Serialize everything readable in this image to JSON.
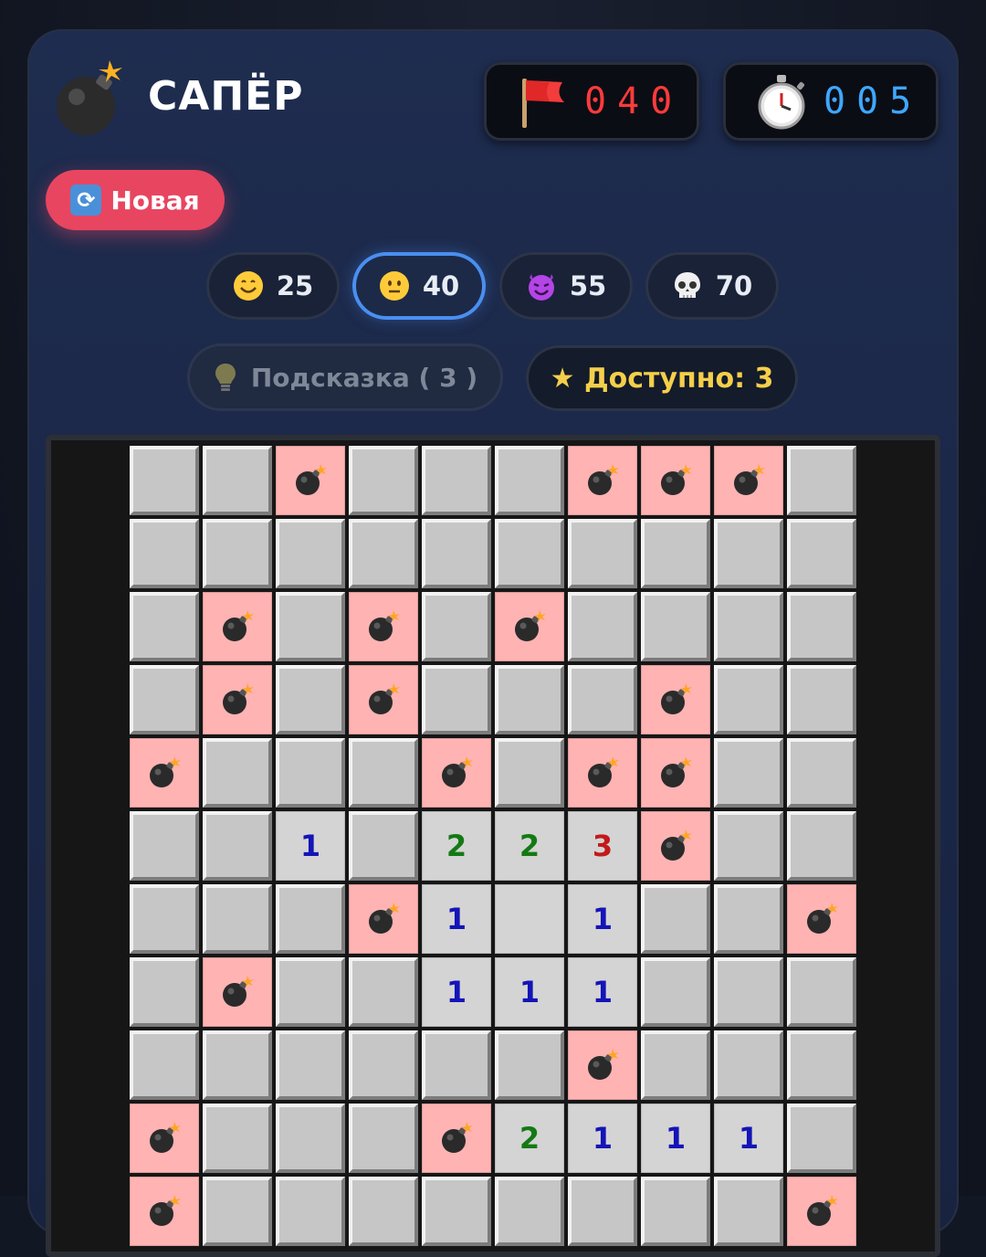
{
  "header": {
    "title": "САПЁР"
  },
  "counters": {
    "flags": "040",
    "timer": "005"
  },
  "new_game": {
    "label": "Новая"
  },
  "difficulties": [
    {
      "face": "smile",
      "value": "25",
      "active": false
    },
    {
      "face": "neutral",
      "value": "40",
      "active": true
    },
    {
      "face": "devil",
      "value": "55",
      "active": false
    },
    {
      "face": "skull",
      "value": "70",
      "active": false
    }
  ],
  "hint": {
    "label": "Подсказка ( 3 )"
  },
  "available": {
    "label": "★ Доступно: 3"
  },
  "board": {
    "columns": 10,
    "rows": [
      [
        "h",
        "h",
        "m",
        "h",
        "h",
        "h",
        "m",
        "m",
        "m",
        "h"
      ],
      [
        "h",
        "h",
        "h",
        "h",
        "h",
        "h",
        "h",
        "h",
        "h",
        "h"
      ],
      [
        "h",
        "m",
        "h",
        "m",
        "h",
        "m",
        "h",
        "h",
        "h",
        "h"
      ],
      [
        "h",
        "m",
        "h",
        "m",
        "h",
        "h",
        "h",
        "m",
        "h",
        "h"
      ],
      [
        "m",
        "h",
        "h",
        "h",
        "m",
        "h",
        "m",
        "m",
        "h",
        "h"
      ],
      [
        "h",
        "h",
        "1",
        "h",
        "2",
        "2",
        "3",
        "m",
        "h",
        "h"
      ],
      [
        "h",
        "h",
        "h",
        "m",
        "1",
        "0",
        "1",
        "h",
        "h",
        "m"
      ],
      [
        "h",
        "m",
        "h",
        "h",
        "1",
        "1",
        "1",
        "h",
        "h",
        "h"
      ],
      [
        "h",
        "h",
        "h",
        "h",
        "h",
        "h",
        "m",
        "h",
        "h",
        "h"
      ],
      [
        "m",
        "h",
        "h",
        "h",
        "m",
        "2",
        "1",
        "1",
        "1",
        "h"
      ],
      [
        "m",
        "h",
        "h",
        "h",
        "h",
        "h",
        "h",
        "h",
        "h",
        "m"
      ]
    ]
  }
}
